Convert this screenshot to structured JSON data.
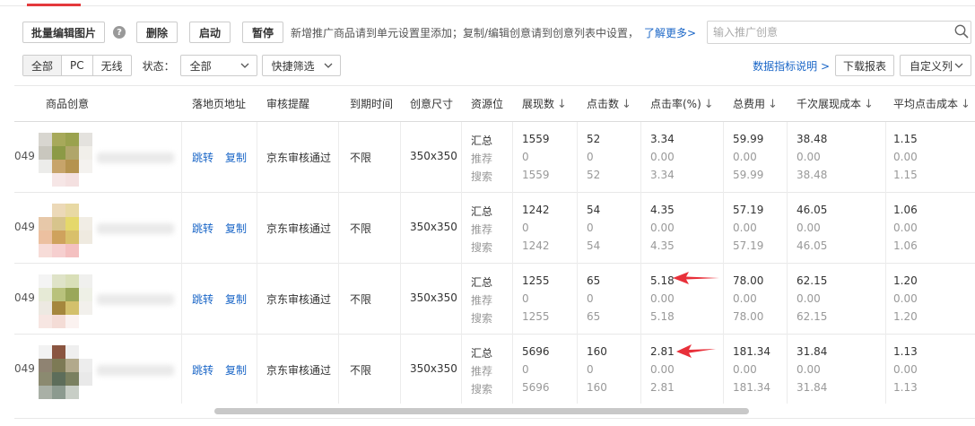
{
  "toolbar": {
    "batch_edit_images": "批量编辑图片",
    "help_glyph": "?",
    "delete": "删除",
    "start": "启动",
    "pause": "暂停",
    "tip": "新增推广商品请到单元设置里添加；复制/编辑创意请到创意列表中设置，",
    "learn_more": "了解更多>"
  },
  "search": {
    "placeholder": "输入推广创意",
    "icon": "search-icon"
  },
  "filters": {
    "platform_tabs": [
      {
        "label": "全部",
        "active": true
      },
      {
        "label": "PC",
        "active": false
      },
      {
        "label": "无线",
        "active": false
      }
    ],
    "status_label": "状态：",
    "status_value": "全部",
    "quick_filter": "快捷筛选"
  },
  "right_tools": {
    "metric_help": "数据指标说明 >",
    "download_report": "下载报表",
    "custom_columns": "自定义列"
  },
  "table": {
    "headers": {
      "creative": "商品创意",
      "landing": "落地页地址",
      "review": "审核提醒",
      "expire": "到期时间",
      "size": "创意尺寸",
      "slot": "资源位",
      "impressions": "展现数",
      "clicks": "点击数",
      "ctr": "点击率(%)",
      "cost": "总费用",
      "cpm": "千次展现成本",
      "cpc": "平均点击成本"
    },
    "sort_arrow": "↓",
    "slot_labels": [
      "汇总",
      "推荐",
      "搜索"
    ],
    "link_jump": "跳转",
    "link_copy": "复制",
    "rows": [
      {
        "id_fragment": "049",
        "review": "京东审核通过",
        "expire": "不限",
        "size": "350x350",
        "impressions": [
          "1559",
          "0",
          "1559"
        ],
        "clicks": [
          "52",
          "0",
          "52"
        ],
        "ctr": [
          "3.34",
          "0.00",
          "3.34"
        ],
        "cost": [
          "59.99",
          "0.00",
          "59.99"
        ],
        "cpm": [
          "38.48",
          "0.00",
          "38.48"
        ],
        "cpc": [
          "1.15",
          "0.00",
          "1.15"
        ]
      },
      {
        "id_fragment": "049",
        "review": "京东审核通过",
        "expire": "不限",
        "size": "350x350",
        "impressions": [
          "1242",
          "0",
          "1242"
        ],
        "clicks": [
          "54",
          "0",
          "54"
        ],
        "ctr": [
          "4.35",
          "0.00",
          "4.35"
        ],
        "cost": [
          "57.19",
          "0.00",
          "57.19"
        ],
        "cpm": [
          "46.05",
          "0.00",
          "46.05"
        ],
        "cpc": [
          "1.06",
          "0.00",
          "1.06"
        ]
      },
      {
        "id_fragment": "049",
        "review": "京东审核通过",
        "expire": "不限",
        "size": "350x350",
        "impressions": [
          "1255",
          "0",
          "1255"
        ],
        "clicks": [
          "65",
          "0",
          "65"
        ],
        "ctr": [
          "5.18",
          "0.00",
          "5.18"
        ],
        "cost": [
          "78.00",
          "0.00",
          "78.00"
        ],
        "cpm": [
          "62.15",
          "0.00",
          "62.15"
        ],
        "cpc": [
          "1.20",
          "0.00",
          "1.20"
        ]
      },
      {
        "id_fragment": "049",
        "review": "京东审核通过",
        "expire": "不限",
        "size": "350x350",
        "impressions": [
          "5696",
          "0",
          "5696"
        ],
        "clicks": [
          "160",
          "0",
          "160"
        ],
        "ctr": [
          "2.81",
          "0.00",
          "2.81"
        ],
        "cost": [
          "181.34",
          "0.00",
          "181.34"
        ],
        "cpm": [
          "31.84",
          "0.00",
          "31.84"
        ],
        "cpc": [
          "1.13",
          "0.00",
          "1.13"
        ]
      }
    ]
  },
  "thumbnails": [
    [
      "#d8d6d0",
      "#a7a95a",
      "#9aa24e",
      "#e4e2de",
      "#c9c7be",
      "#8c9a46",
      "#b0a66a",
      "#f1efea",
      "#ececea",
      "#c7a46a",
      "#b5934f",
      "#f4f2ef",
      "#ffffff",
      "#f6e6e6",
      "#f4e0e0",
      "#ffffff"
    ],
    [
      "#ffffff",
      "#ecd9b8",
      "#e8d9a4",
      "#ffffff",
      "#e7c8a9",
      "#d7c48c",
      "#e5d86b",
      "#f1ede5",
      "#ecc0a0",
      "#cfa25d",
      "#d9c06a",
      "#efeae0",
      "#f7dcd8",
      "#f6cfcf",
      "#f4c0c0",
      "#ffffff"
    ],
    [
      "#f4f4f4",
      "#dfe3c8",
      "#d9dfb8",
      "#f0f0ee",
      "#e6ead6",
      "#b9c27c",
      "#9aa75a",
      "#eef0e6",
      "#ede9e2",
      "#a5873d",
      "#d3c06c",
      "#f2f0ec",
      "#f7e6e2",
      "#f4dcd6",
      "#fbf2f0",
      "#ffffff"
    ],
    [
      "#f2f2f2",
      "#8a5540",
      "#efefef",
      "#ffffff",
      "#8f8372",
      "#7d7a55",
      "#b2a98c",
      "#ededed",
      "#8b8a70",
      "#5d6d5a",
      "#7a8060",
      "#e9e9e9",
      "#a9b0a6",
      "#8c9a8f",
      "#c8cec6",
      "#ffffff"
    ]
  ],
  "colors": {
    "accent_red": "#e4393c",
    "link_blue": "#1a66c7",
    "arrow_red": "#e8303a"
  }
}
